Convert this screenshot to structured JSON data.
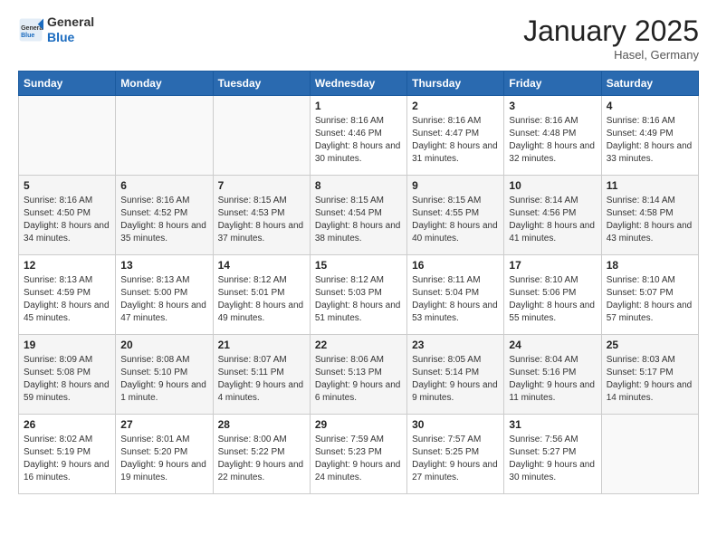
{
  "header": {
    "logo_general": "General",
    "logo_blue": "Blue",
    "month_title": "January 2025",
    "location": "Hasel, Germany"
  },
  "days_of_week": [
    "Sunday",
    "Monday",
    "Tuesday",
    "Wednesday",
    "Thursday",
    "Friday",
    "Saturday"
  ],
  "weeks": [
    [
      {
        "day": "",
        "sunrise": "",
        "sunset": "",
        "daylight": ""
      },
      {
        "day": "",
        "sunrise": "",
        "sunset": "",
        "daylight": ""
      },
      {
        "day": "",
        "sunrise": "",
        "sunset": "",
        "daylight": ""
      },
      {
        "day": "1",
        "sunrise": "Sunrise: 8:16 AM",
        "sunset": "Sunset: 4:46 PM",
        "daylight": "Daylight: 8 hours and 30 minutes."
      },
      {
        "day": "2",
        "sunrise": "Sunrise: 8:16 AM",
        "sunset": "Sunset: 4:47 PM",
        "daylight": "Daylight: 8 hours and 31 minutes."
      },
      {
        "day": "3",
        "sunrise": "Sunrise: 8:16 AM",
        "sunset": "Sunset: 4:48 PM",
        "daylight": "Daylight: 8 hours and 32 minutes."
      },
      {
        "day": "4",
        "sunrise": "Sunrise: 8:16 AM",
        "sunset": "Sunset: 4:49 PM",
        "daylight": "Daylight: 8 hours and 33 minutes."
      }
    ],
    [
      {
        "day": "5",
        "sunrise": "Sunrise: 8:16 AM",
        "sunset": "Sunset: 4:50 PM",
        "daylight": "Daylight: 8 hours and 34 minutes."
      },
      {
        "day": "6",
        "sunrise": "Sunrise: 8:16 AM",
        "sunset": "Sunset: 4:52 PM",
        "daylight": "Daylight: 8 hours and 35 minutes."
      },
      {
        "day": "7",
        "sunrise": "Sunrise: 8:15 AM",
        "sunset": "Sunset: 4:53 PM",
        "daylight": "Daylight: 8 hours and 37 minutes."
      },
      {
        "day": "8",
        "sunrise": "Sunrise: 8:15 AM",
        "sunset": "Sunset: 4:54 PM",
        "daylight": "Daylight: 8 hours and 38 minutes."
      },
      {
        "day": "9",
        "sunrise": "Sunrise: 8:15 AM",
        "sunset": "Sunset: 4:55 PM",
        "daylight": "Daylight: 8 hours and 40 minutes."
      },
      {
        "day": "10",
        "sunrise": "Sunrise: 8:14 AM",
        "sunset": "Sunset: 4:56 PM",
        "daylight": "Daylight: 8 hours and 41 minutes."
      },
      {
        "day": "11",
        "sunrise": "Sunrise: 8:14 AM",
        "sunset": "Sunset: 4:58 PM",
        "daylight": "Daylight: 8 hours and 43 minutes."
      }
    ],
    [
      {
        "day": "12",
        "sunrise": "Sunrise: 8:13 AM",
        "sunset": "Sunset: 4:59 PM",
        "daylight": "Daylight: 8 hours and 45 minutes."
      },
      {
        "day": "13",
        "sunrise": "Sunrise: 8:13 AM",
        "sunset": "Sunset: 5:00 PM",
        "daylight": "Daylight: 8 hours and 47 minutes."
      },
      {
        "day": "14",
        "sunrise": "Sunrise: 8:12 AM",
        "sunset": "Sunset: 5:01 PM",
        "daylight": "Daylight: 8 hours and 49 minutes."
      },
      {
        "day": "15",
        "sunrise": "Sunrise: 8:12 AM",
        "sunset": "Sunset: 5:03 PM",
        "daylight": "Daylight: 8 hours and 51 minutes."
      },
      {
        "day": "16",
        "sunrise": "Sunrise: 8:11 AM",
        "sunset": "Sunset: 5:04 PM",
        "daylight": "Daylight: 8 hours and 53 minutes."
      },
      {
        "day": "17",
        "sunrise": "Sunrise: 8:10 AM",
        "sunset": "Sunset: 5:06 PM",
        "daylight": "Daylight: 8 hours and 55 minutes."
      },
      {
        "day": "18",
        "sunrise": "Sunrise: 8:10 AM",
        "sunset": "Sunset: 5:07 PM",
        "daylight": "Daylight: 8 hours and 57 minutes."
      }
    ],
    [
      {
        "day": "19",
        "sunrise": "Sunrise: 8:09 AM",
        "sunset": "Sunset: 5:08 PM",
        "daylight": "Daylight: 8 hours and 59 minutes."
      },
      {
        "day": "20",
        "sunrise": "Sunrise: 8:08 AM",
        "sunset": "Sunset: 5:10 PM",
        "daylight": "Daylight: 9 hours and 1 minute."
      },
      {
        "day": "21",
        "sunrise": "Sunrise: 8:07 AM",
        "sunset": "Sunset: 5:11 PM",
        "daylight": "Daylight: 9 hours and 4 minutes."
      },
      {
        "day": "22",
        "sunrise": "Sunrise: 8:06 AM",
        "sunset": "Sunset: 5:13 PM",
        "daylight": "Daylight: 9 hours and 6 minutes."
      },
      {
        "day": "23",
        "sunrise": "Sunrise: 8:05 AM",
        "sunset": "Sunset: 5:14 PM",
        "daylight": "Daylight: 9 hours and 9 minutes."
      },
      {
        "day": "24",
        "sunrise": "Sunrise: 8:04 AM",
        "sunset": "Sunset: 5:16 PM",
        "daylight": "Daylight: 9 hours and 11 minutes."
      },
      {
        "day": "25",
        "sunrise": "Sunrise: 8:03 AM",
        "sunset": "Sunset: 5:17 PM",
        "daylight": "Daylight: 9 hours and 14 minutes."
      }
    ],
    [
      {
        "day": "26",
        "sunrise": "Sunrise: 8:02 AM",
        "sunset": "Sunset: 5:19 PM",
        "daylight": "Daylight: 9 hours and 16 minutes."
      },
      {
        "day": "27",
        "sunrise": "Sunrise: 8:01 AM",
        "sunset": "Sunset: 5:20 PM",
        "daylight": "Daylight: 9 hours and 19 minutes."
      },
      {
        "day": "28",
        "sunrise": "Sunrise: 8:00 AM",
        "sunset": "Sunset: 5:22 PM",
        "daylight": "Daylight: 9 hours and 22 minutes."
      },
      {
        "day": "29",
        "sunrise": "Sunrise: 7:59 AM",
        "sunset": "Sunset: 5:23 PM",
        "daylight": "Daylight: 9 hours and 24 minutes."
      },
      {
        "day": "30",
        "sunrise": "Sunrise: 7:57 AM",
        "sunset": "Sunset: 5:25 PM",
        "daylight": "Daylight: 9 hours and 27 minutes."
      },
      {
        "day": "31",
        "sunrise": "Sunrise: 7:56 AM",
        "sunset": "Sunset: 5:27 PM",
        "daylight": "Daylight: 9 hours and 30 minutes."
      },
      {
        "day": "",
        "sunrise": "",
        "sunset": "",
        "daylight": ""
      }
    ]
  ]
}
